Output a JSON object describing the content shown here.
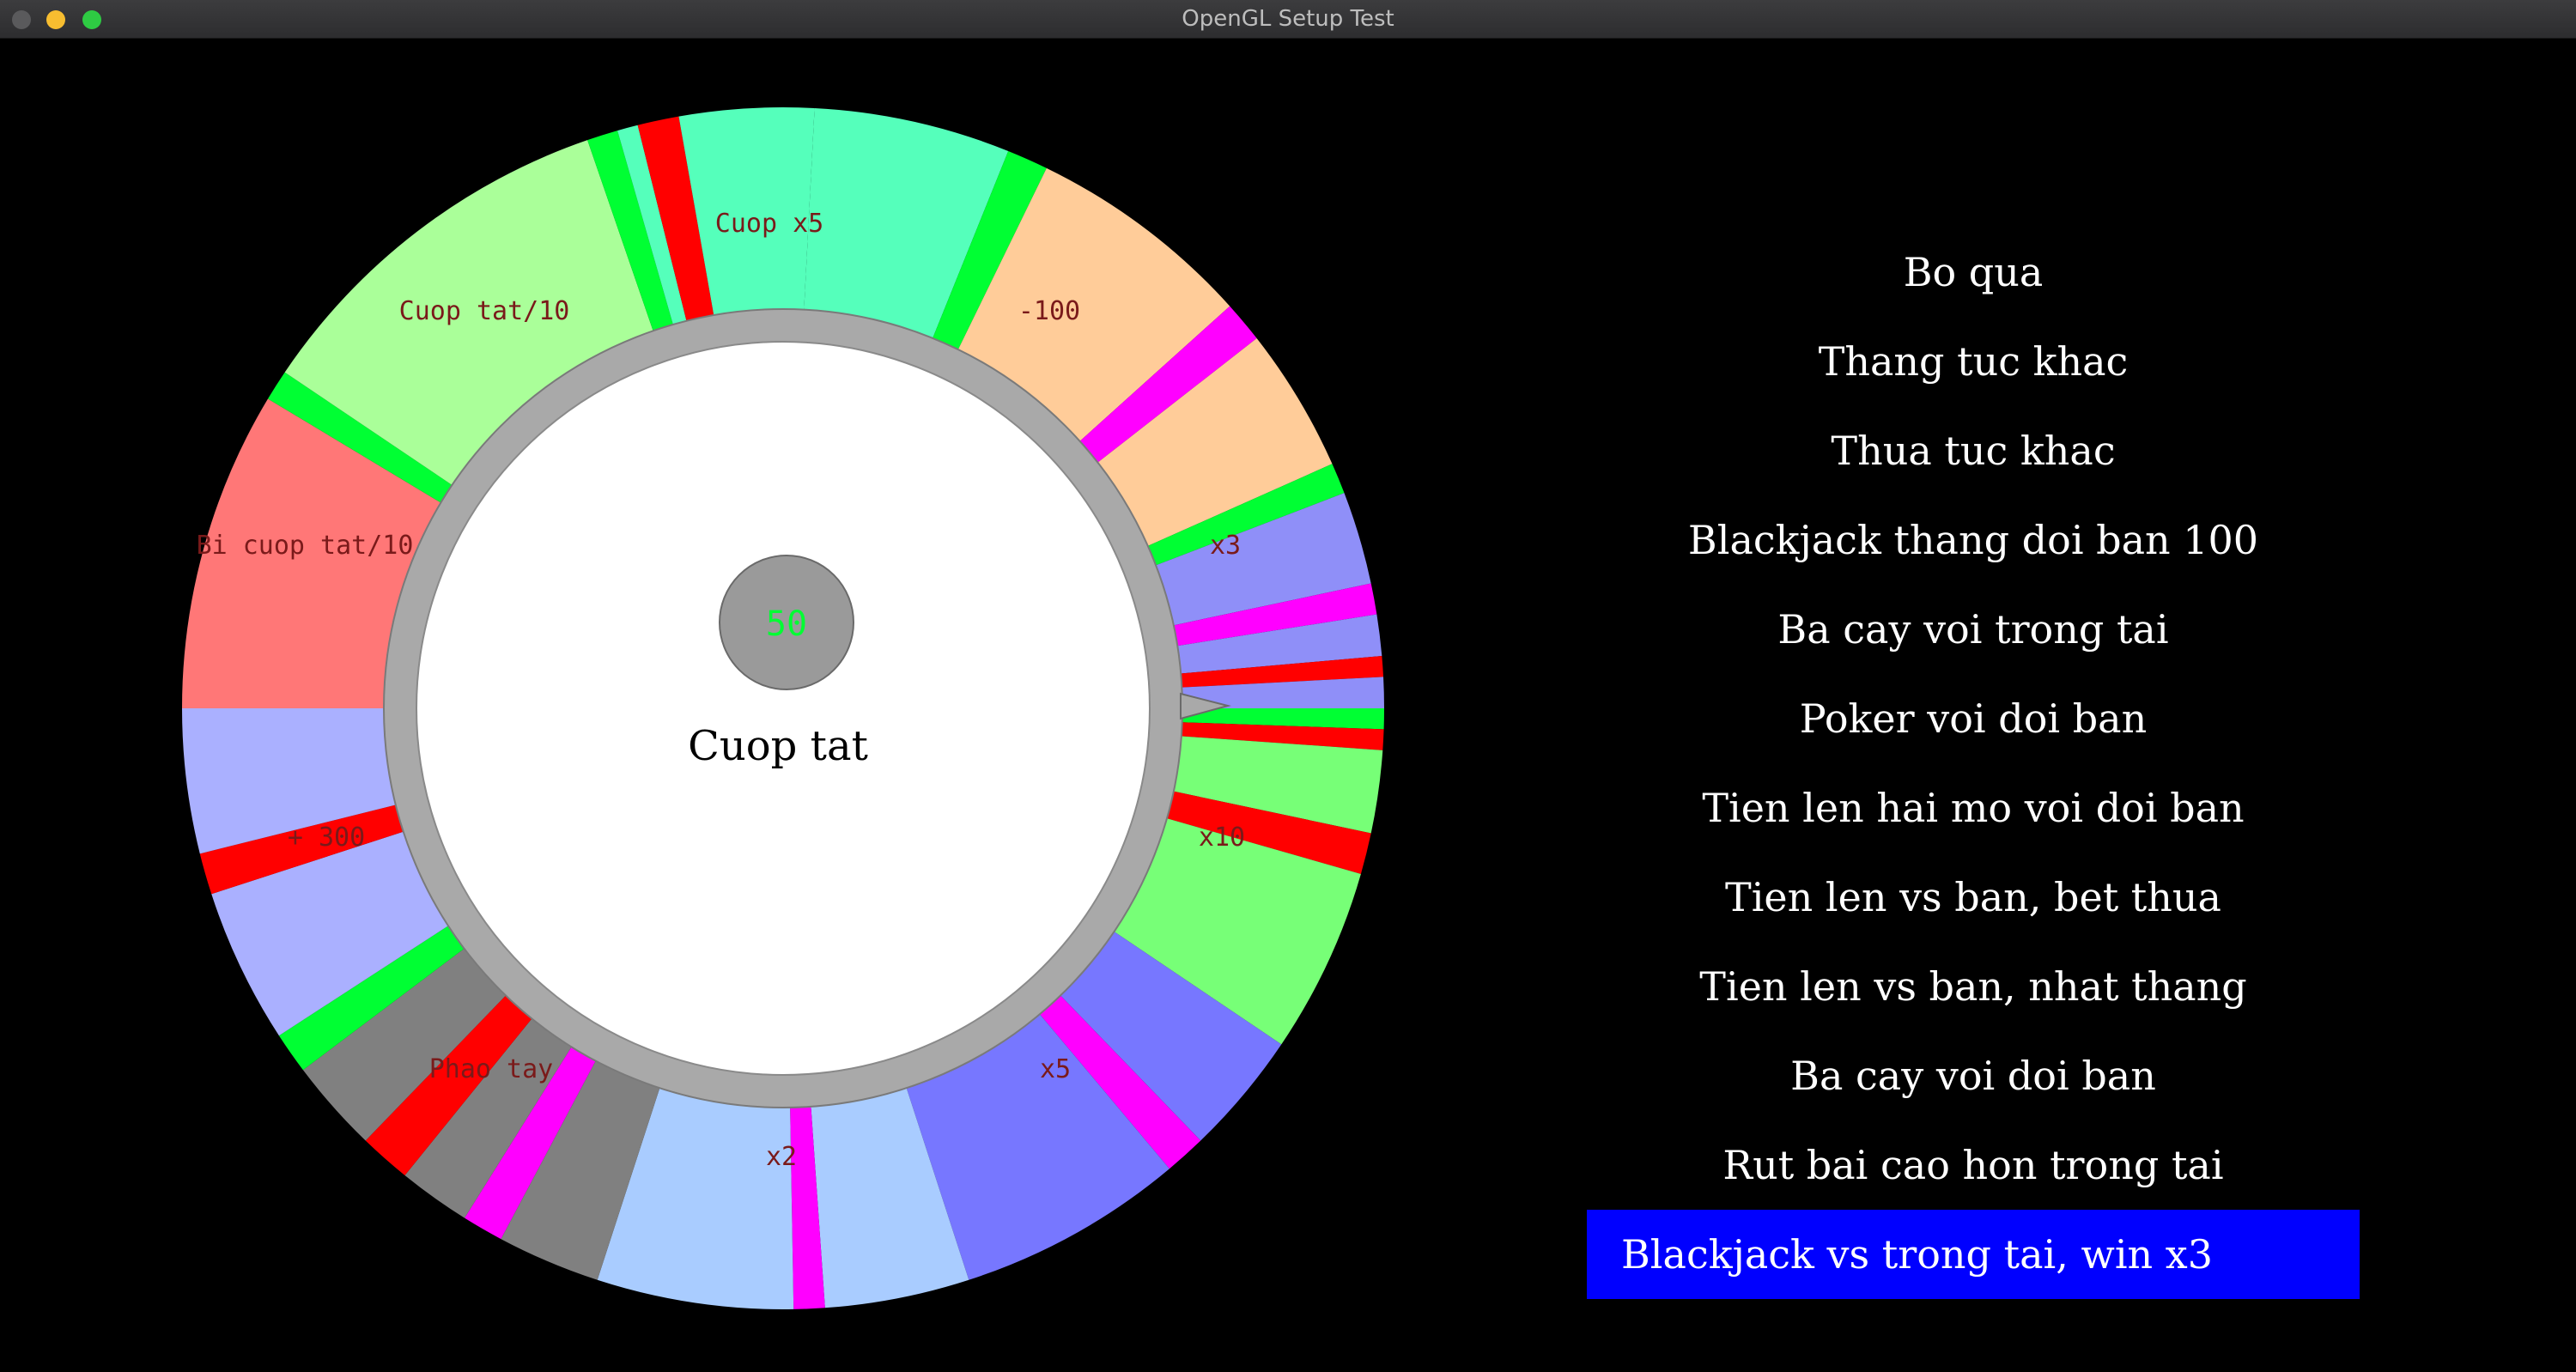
{
  "window": {
    "title": "OpenGL Setup Test"
  },
  "wheel": {
    "center_value": "50",
    "center_text": "Cuop tat",
    "colors": {
      "ring": "#a9a9a9",
      "hub": "#9a9a9a",
      "hub_text": "#00ff33",
      "pointer": "#a9a9a9"
    },
    "labels": [
      {
        "text": "Cuop x5"
      },
      {
        "text": "-100"
      },
      {
        "text": "x3"
      },
      {
        "text": "x10"
      },
      {
        "text": "x5"
      },
      {
        "text": "x2"
      },
      {
        "text": "Phao tay"
      },
      {
        "text": "+ 300"
      },
      {
        "text": "Bi cuop tat/10"
      },
      {
        "text": "Cuop tat/10"
      }
    ]
  },
  "menu": {
    "items": [
      {
        "label": "Bo qua",
        "selected": false
      },
      {
        "label": "Thang tuc khac",
        "selected": false
      },
      {
        "label": "Thua tuc khac",
        "selected": false
      },
      {
        "label": "Blackjack thang doi ban 100",
        "selected": false
      },
      {
        "label": "Ba cay voi trong tai",
        "selected": false
      },
      {
        "label": "Poker voi doi ban",
        "selected": false
      },
      {
        "label": "Tien len hai mo voi doi ban",
        "selected": false
      },
      {
        "label": "Tien len vs ban, bet thua",
        "selected": false
      },
      {
        "label": "Tien len vs ban, nhat thang",
        "selected": false
      },
      {
        "label": "Ba cay voi doi ban",
        "selected": false
      },
      {
        "label": "Rut bai cao hon trong tai",
        "selected": false
      },
      {
        "label": "Blackjack vs trong tai, win x3",
        "selected": true
      }
    ],
    "selected_color": "#0000ff"
  }
}
